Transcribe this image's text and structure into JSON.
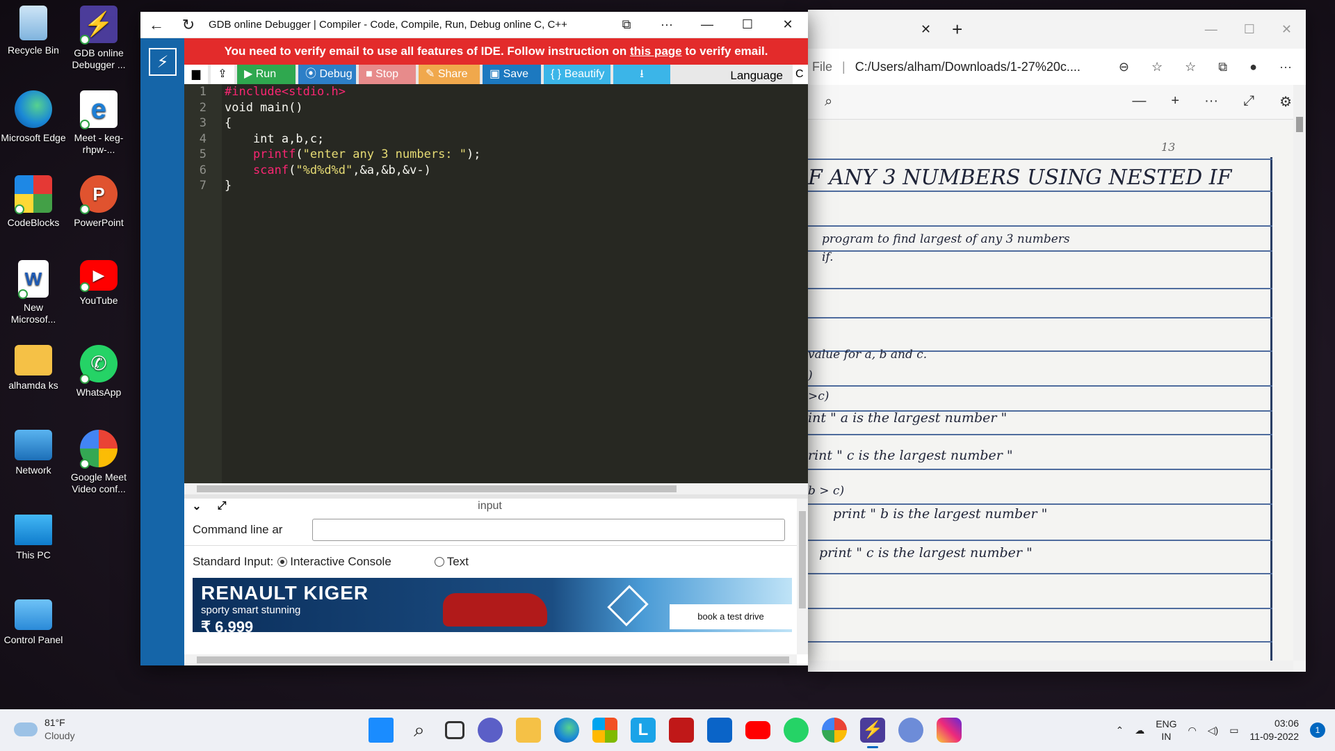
{
  "desktop": {
    "icons": [
      {
        "label": "Recycle Bin"
      },
      {
        "label": "GDB online Debugger ..."
      },
      {
        "label": "Microsoft Edge"
      },
      {
        "label": "Meet - keg-rhpw-..."
      },
      {
        "label": "CodeBlocks"
      },
      {
        "label": "PowerPoint"
      },
      {
        "label": "New Microsof..."
      },
      {
        "label": "YouTube"
      },
      {
        "label": "alhamda ks"
      },
      {
        "label": "WhatsApp"
      },
      {
        "label": "Network"
      },
      {
        "label": "Google Meet Video conf..."
      },
      {
        "label": "This PC"
      },
      {
        "label": "Control Panel"
      }
    ]
  },
  "gdb": {
    "title": "GDB online Debugger | Compiler - Code, Compile, Run, Debug online C, C++",
    "banner": {
      "before": "You need to verify email to use all features of IDE. Follow instruction on ",
      "link": "this page",
      "after": " to verify email."
    },
    "toolbar": {
      "run": "▶ Run",
      "debug": "⦿ Debug",
      "stop": "■ Stop",
      "share": "✎ Share",
      "save": "▣ Save",
      "beautify": "{ } Beautify",
      "download": "⭳",
      "language_label": "Language",
      "language_value": "C"
    },
    "code": {
      "line_numbers": [
        "1",
        "2",
        "3",
        "4",
        "5",
        "6",
        "7"
      ],
      "lines": [
        {
          "a": "#include<stdio.h>",
          "b": "",
          "c": ""
        },
        {
          "a": "",
          "b": "void main()",
          "c": ""
        },
        {
          "a": "",
          "b": "{",
          "c": ""
        },
        {
          "a": "",
          "b": "    int a,b,c;",
          "c": ""
        },
        {
          "a": "    printf",
          "b": "(",
          "c": "\"enter any 3 numbers: \"",
          "d": ");"
        },
        {
          "a": "    scanf",
          "b": "(",
          "c": "\"%d%d%d\"",
          "d": ",&a,&b,&v-)"
        },
        {
          "a": "",
          "b": "}",
          "c": ""
        }
      ]
    },
    "input_panel": {
      "header": "input",
      "command_line_label": "Command line arguments",
      "standard_input_label": "Standard Input:",
      "option_console": "Interactive Console",
      "option_text": "Text",
      "ad": {
        "brand": "RENAULT KIGER",
        "tagline": "sporty smart stunning",
        "price": "₹ 6,999",
        "cta": "book a test drive"
      }
    }
  },
  "edge": {
    "address_prefix": "File",
    "address": "C:/Users/alham/Downloads/1-27%20c....",
    "page_number": "13",
    "notes": {
      "heading": "F ANY 3 NUMBERS USING NESTED IF",
      "line1": "program   to   find   largest   of   any   3   numbers",
      "line2": "if.",
      "line3": "value   for   a, b  and c.",
      "line4": ")",
      "line5": ">c)",
      "line6": "int \" a   is   the   largest   number \"",
      "line7": "rint \" c   is   the   largest   number \"",
      "line8": "b > c)",
      "line9": "print \" b  is  the  largest  number \"",
      "line10": "print \" c  is  the  largest  number \""
    }
  },
  "taskbar": {
    "weather_temp": "81°F",
    "weather_desc": "Cloudy",
    "lang_top": "ENG",
    "lang_bottom": "IN",
    "time": "03:06",
    "date": "11-09-2022",
    "notifications": "1"
  }
}
